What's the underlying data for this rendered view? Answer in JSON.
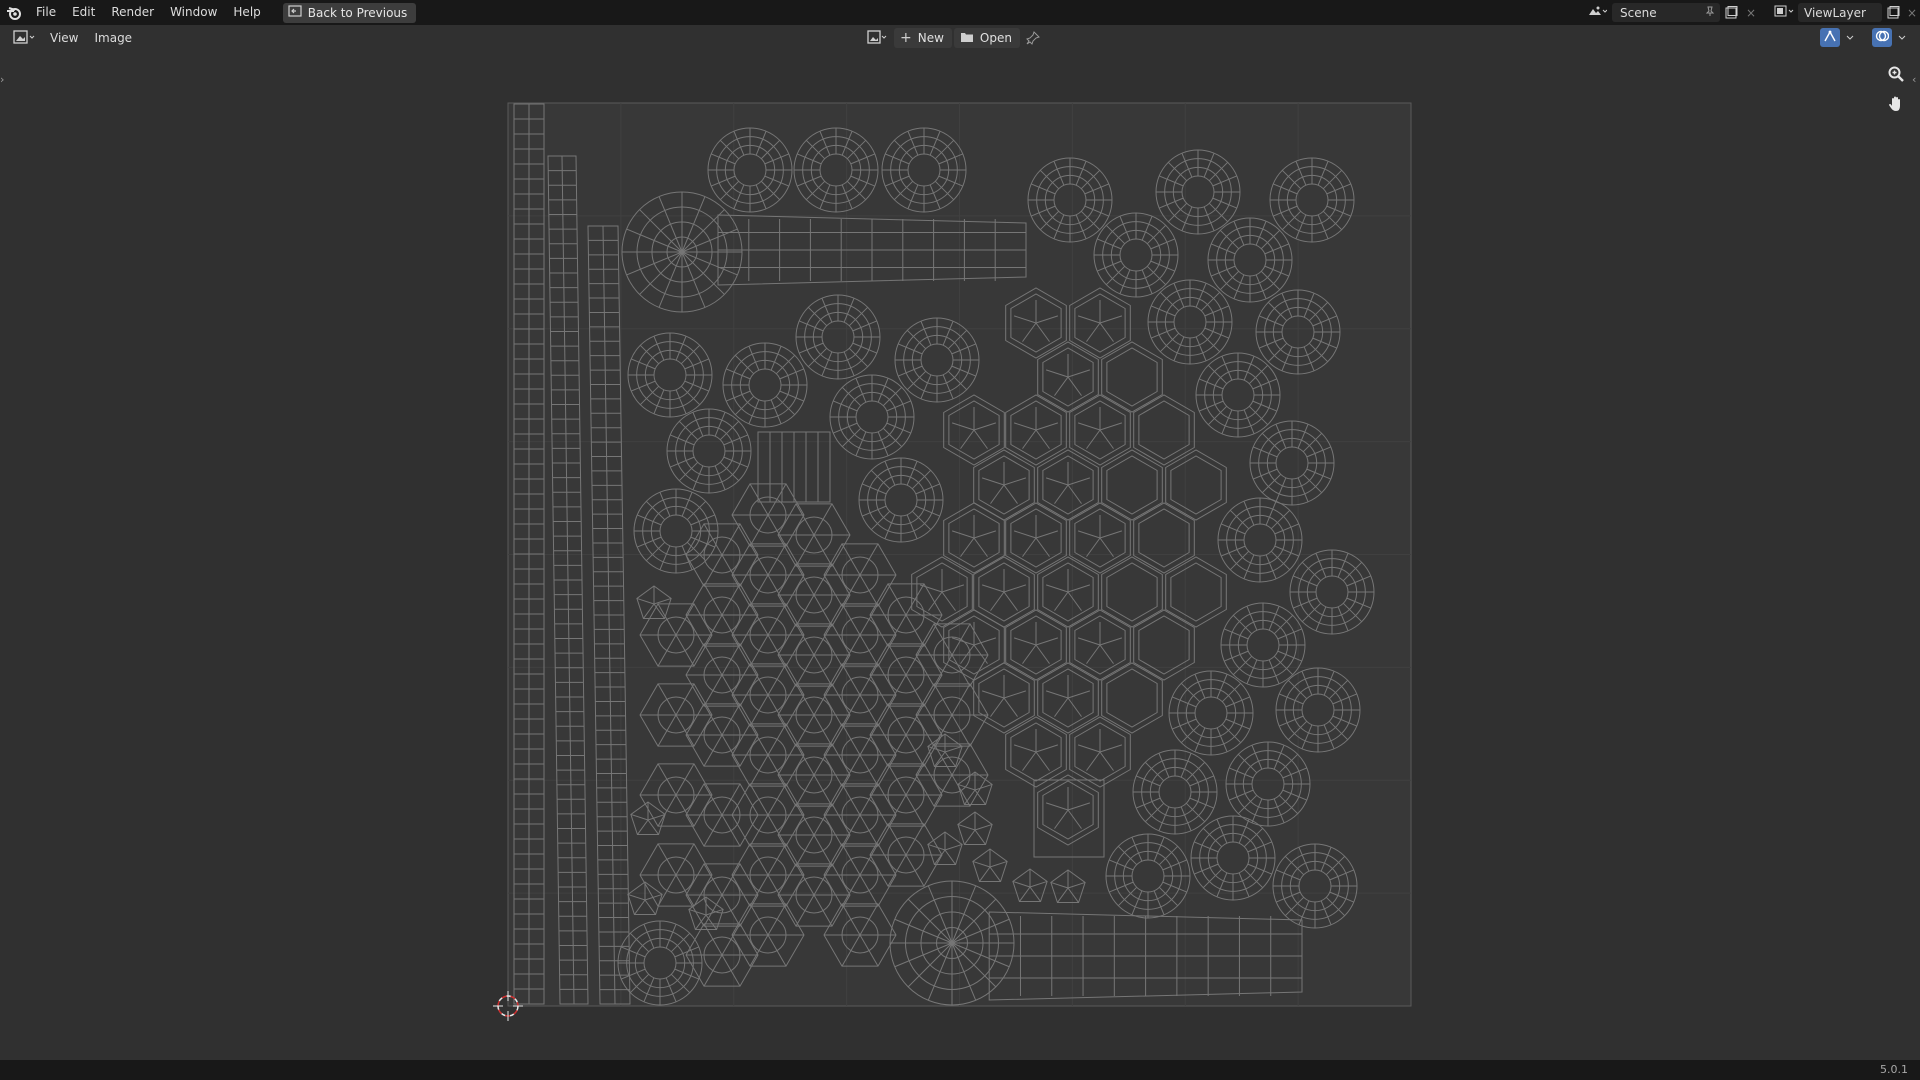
{
  "topbar": {
    "menus": [
      "File",
      "Edit",
      "Render",
      "Window",
      "Help"
    ],
    "back_button": "Back to Previous",
    "scene_label": "Scene",
    "viewlayer_label": "ViewLayer"
  },
  "header": {
    "menus": [
      "View",
      "Image"
    ],
    "new_label": "New",
    "open_label": "Open"
  },
  "status": {
    "version": "5.0.1"
  },
  "icons": {
    "logo": "blender-logo-icon",
    "back": "back-icon",
    "editor_type": "image-editor-icon",
    "scene": "scene-icon",
    "pin": "pin-icon",
    "new_scene": "new-scene-icon",
    "viewlayer": "viewlayer-icon",
    "zoom": "zoom-icon",
    "pan": "hand-icon",
    "cursor": "2d-cursor-icon"
  },
  "colors": {
    "background": "#303030",
    "topbar": "#181818",
    "canvas": "#383838",
    "wire": "#767676",
    "accent_blue": "#4772b3"
  }
}
